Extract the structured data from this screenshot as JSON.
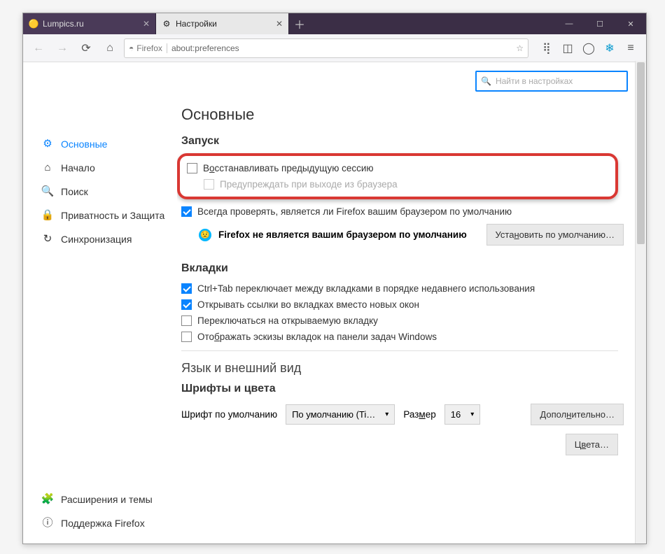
{
  "tabs": {
    "t1": "Lumpics.ru",
    "t2": "Настройки"
  },
  "url": {
    "prefix": "Firefox",
    "value": "about:preferences"
  },
  "search": {
    "placeholder": "Найти в настройках"
  },
  "sidebar": {
    "general": "Основные",
    "home": "Начало",
    "search": "Поиск",
    "privacy": "Приватность и Защита",
    "sync": "Синхронизация",
    "ext": "Расширения и темы",
    "support": "Поддержка Firefox"
  },
  "main": {
    "title": "Основные",
    "startup": "Запуск",
    "restore": "Восстанавливать предыдущую сессию",
    "warn": "Предупреждать при выходе из браузера",
    "alwayscheck": "Всегда проверять, является ли Firefox вашим браузером по умолчанию",
    "notdefault": "Firefox не является вашим браузером по умолчанию",
    "setdefault": "Установить по умолчанию…",
    "tabs": "Вкладки",
    "ctrltab": "Ctrl+Tab переключает между вкладками в порядке недавнего использования",
    "openlinks": "Открывать ссылки во вкладках вместо новых окон",
    "switchto": "Переключаться на открываемую вкладку",
    "thumbs": "Отображать эскизы вкладок на панели задач Windows",
    "lang": "Язык и внешний вид",
    "fonts": "Шрифты и цвета",
    "deffont": "Шрифт по умолчанию",
    "fontval": "По умолчанию (Ti…",
    "size": "Размер",
    "sizeval": "16",
    "advanced": "Дополнительно…",
    "colors": "Цвета…"
  }
}
